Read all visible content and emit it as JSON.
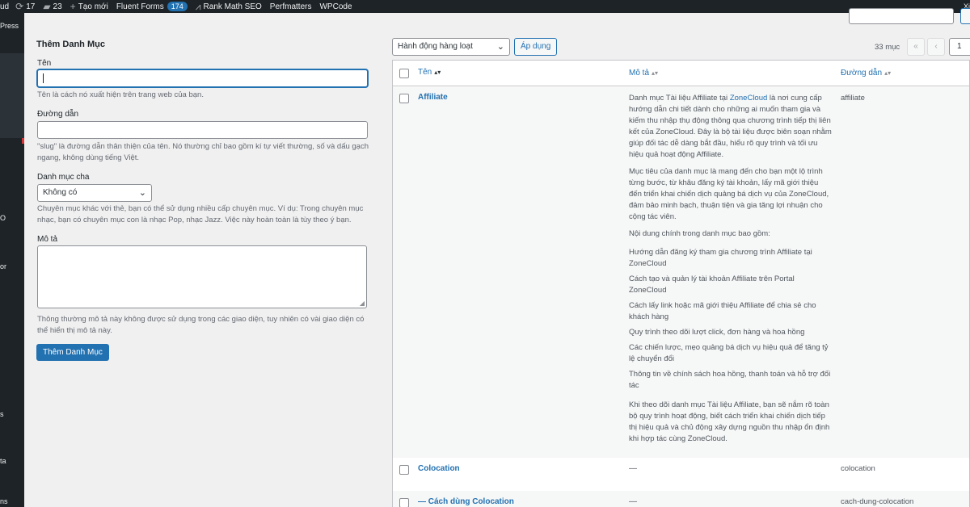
{
  "adminbar": {
    "site": "ud",
    "updates_count": "17",
    "comments_count": "23",
    "new_label": "Tạo mới",
    "fluent_forms": "Fluent Forms",
    "fluent_badge": "174",
    "rank_math": "Rank Math SEO",
    "perfmatters": "Perfmatters",
    "wpcode": "WPCode",
    "right_text": "Xi"
  },
  "sidebar": {
    "items": [
      {
        "label": "Press"
      },
      {
        "label": "O"
      },
      {
        "label": "or"
      },
      {
        "label": "s"
      },
      {
        "label": "ta"
      },
      {
        "label": "ns"
      }
    ]
  },
  "form": {
    "title": "Thêm Danh Mục",
    "name_label": "Tên",
    "name_help": "Tên là cách nó xuất hiện trên trang web của bạn.",
    "slug_label": "Đường dẫn",
    "slug_help": "\"slug\" là đường dẫn thân thiện của tên. Nó thường chỉ bao gồm kí tự viết thường, số và dấu gạch ngang, không dùng tiếng Việt.",
    "parent_label": "Danh mục cha",
    "parent_value": "Không có",
    "parent_help": "Chuyên mục khác với thẻ, bạn có thể sử dụng nhiều cấp chuyên mục. Ví dụ: Trong chuyên mục nhạc, bạn có chuyên mục con là nhạc Pop, nhạc Jazz. Việc này hoàn toàn là tùy theo ý bạn.",
    "desc_label": "Mô tả",
    "desc_help": "Thông thường mô tả này không được sử dụng trong các giao diện, tuy nhiên có vài giao diện có thể hiển thị mô tả này.",
    "submit_label": "Thêm Danh Mục"
  },
  "toolbar": {
    "bulk_action": "Hành động hàng loạt",
    "apply_label": "Áp dụng",
    "count": "33 mục",
    "first_page": "«",
    "prev_page": "‹",
    "current_page": "1"
  },
  "table": {
    "headers": {
      "name": "Tên",
      "description": "Mô tả",
      "slug": "Đường dẫn"
    },
    "rows": [
      {
        "name": "Affiliate",
        "slug": "affiliate",
        "desc_intro_before": "Danh mục Tài liệu Affiliate tại ",
        "desc_intro_link": "ZoneCloud",
        "desc_intro_after": " là nơi cung cấp hướng dẫn chi tiết dành cho những ai muốn tham gia và kiếm thu nhập thụ động thông qua chương trình tiếp thị liên kết của ZoneCloud. Đây là bộ tài liệu được biên soạn nhằm giúp đối tác dễ dàng bắt đầu, hiểu rõ quy trình và tối ưu hiệu quả hoạt động Affiliate.",
        "desc_p2": "Mục tiêu của danh mục là mang đến cho bạn một lộ trình từng bước, từ khâu đăng ký tài khoản, lấy mã giới thiệu đến triển khai chiến dịch quảng bá dịch vụ của ZoneCloud, đảm bảo minh bạch, thuận tiện và gia tăng lợi nhuận cho cộng tác viên.",
        "desc_p3": "Nội dung chính trong danh mục bao gồm:",
        "desc_list": [
          "Hướng dẫn đăng ký tham gia chương trình Affiliate tại ZoneCloud",
          "Cách tạo và quản lý tài khoản Affiliate trên Portal ZoneCloud",
          "Cách lấy link hoặc mã giới thiệu Affiliate để chia sẻ cho khách hàng",
          "Quy trình theo dõi lượt click, đơn hàng và hoa hồng",
          "Các chiến lược, mẹo quảng bá dịch vụ hiệu quả để tăng tỷ lệ chuyển đổi",
          "Thông tin về chính sách hoa hồng, thanh toán và hỗ trợ đối tác"
        ],
        "desc_p4": "Khi theo dõi danh mục Tài liệu Affiliate, bạn sẽ nắm rõ toàn bộ quy trình hoạt động, biết cách triển khai chiến dịch tiếp thị hiệu quả và chủ động xây dựng nguồn thu nhập ổn định khi hợp tác cùng ZoneCloud."
      },
      {
        "name": "Colocation",
        "description": "—",
        "slug": "colocation"
      },
      {
        "name": "— Cách dùng Colocation",
        "description": "—",
        "slug": "cach-dung-colocation"
      }
    ]
  }
}
